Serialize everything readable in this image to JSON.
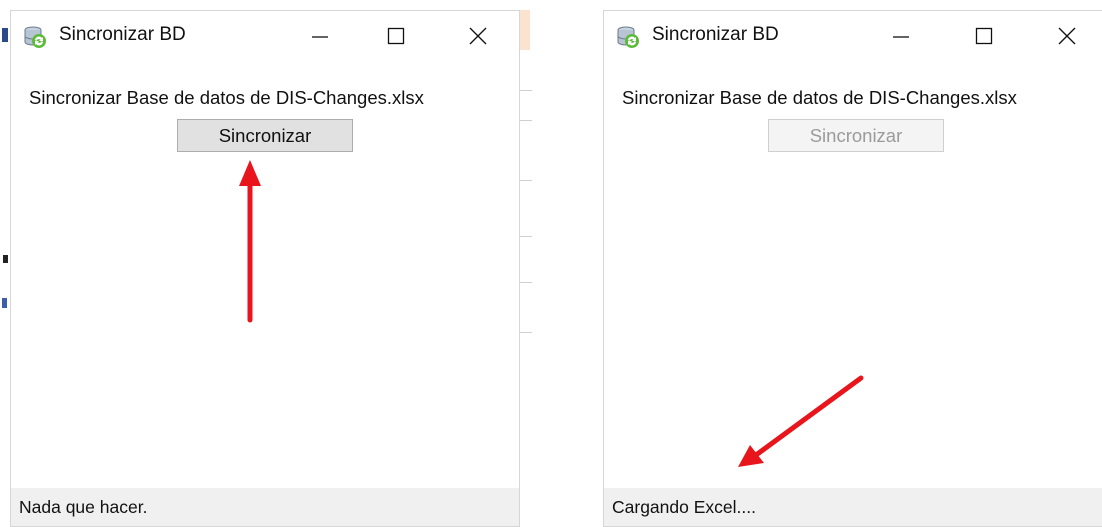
{
  "windows": [
    {
      "title": "Sincronizar BD",
      "prompt": "Sincronizar Base de datos de DIS-Changes.xlsx",
      "button_label": "Sincronizar",
      "button_state": "enabled",
      "status": "Nada que hacer."
    },
    {
      "title": "Sincronizar BD",
      "prompt": "Sincronizar Base de datos de DIS-Changes.xlsx",
      "button_label": "Sincronizar",
      "button_state": "disabled",
      "status": "Cargando Excel...."
    }
  ],
  "colors": {
    "annotation_arrow": "#e8161c",
    "statusbar": "#f0f0f0",
    "button_enabled": "#e1e1e1",
    "button_disabled": "#f4f4f4"
  }
}
